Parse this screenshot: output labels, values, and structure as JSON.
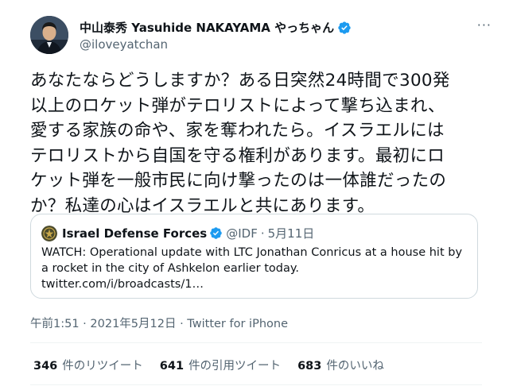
{
  "tweet": {
    "author": {
      "display_name": "中山泰秀 Yasuhide NAKAYAMA やっちゃん",
      "handle": "@iloveyatchan",
      "avatar_icon": "person-avatar-icon",
      "verified": true
    },
    "more_icon": "more-options-icon",
    "more_label": "···",
    "text": "あなたならどうしますか？ある日突然24時間で300発\n以上のロケット弾がテロリストによって撃ち込まれ、\n愛する家族の命や、家を奪われたら。イスラエルには\nテロリストから自国を守る権利があります。最初にロ\nケット弾を一般市民に向け撃ったのは一体誰だったの\nか？私達の心はイスラエルと共にあります。",
    "quoted": {
      "name": "Israel Defense Forces",
      "handle": "@IDF",
      "separator": "·",
      "date": "5月11日",
      "verified": true,
      "text": "WATCH: Operational update with LTC Jonathan Conricus at a house hit by\na rocket in the city of Ashkelon earlier today.\ntwitter.com/i/broadcasts/1…"
    },
    "timestamp": "午前1:51 · 2021年5月12日 · Twitter for iPhone",
    "stats": [
      {
        "count": "346",
        "label": "件のリツイート"
      },
      {
        "count": "641",
        "label": "件の引用ツイート"
      },
      {
        "count": "683",
        "label": "件のいいね"
      }
    ]
  },
  "colors": {
    "verified_blue": "#1d9bf0",
    "secondary_text": "#536471",
    "border": "#cfd9de"
  }
}
